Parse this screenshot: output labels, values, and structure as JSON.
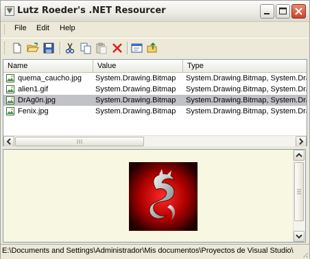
{
  "window": {
    "title": "Lutz Roeder's .NET Resourcer"
  },
  "menu": {
    "items": [
      "File",
      "Edit",
      "Help"
    ]
  },
  "toolbar": {
    "buttons": [
      "new-file",
      "open-folder",
      "save",
      "cut",
      "copy",
      "paste",
      "delete",
      "edit-resource",
      "export-folder"
    ]
  },
  "list": {
    "columns": [
      "Name",
      "Value",
      "Type"
    ],
    "rows": [
      {
        "name": "quema_caucho.jpg",
        "value": "System.Drawing.Bitmap",
        "type": "System.Drawing.Bitmap, System.Dra",
        "selected": false
      },
      {
        "name": "alien1.gif",
        "value": "System.Drawing.Bitmap",
        "type": "System.Drawing.Bitmap, System.Dra",
        "selected": false
      },
      {
        "name": "DrAg0n.jpg",
        "value": "System.Drawing.Bitmap",
        "type": "System.Drawing.Bitmap, System.Dra",
        "selected": true
      },
      {
        "name": "Fenix.jpg",
        "value": "System.Drawing.Bitmap",
        "type": "System.Drawing.Bitmap, System.Dra",
        "selected": false
      }
    ]
  },
  "colors": {
    "selection": "#c1c1c8",
    "preview_bg": "#f8f7e2",
    "close_button": "#c6452a"
  },
  "status": {
    "path": "E:\\Documents and Settings\\Administrador\\Mis documentos\\Proyectos de Visual Studio\\Re"
  }
}
